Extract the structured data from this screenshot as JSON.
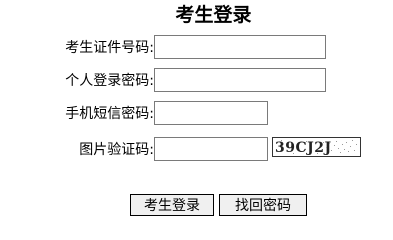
{
  "title": "考生登录",
  "form": {
    "fields": [
      {
        "label": "考生证件号码:",
        "value": ""
      },
      {
        "label": "个人登录密码:",
        "value": ""
      },
      {
        "label": "手机短信密码:",
        "value": ""
      },
      {
        "label": "图片验证码:",
        "value": ""
      }
    ],
    "captcha_text": "39CJ2J"
  },
  "buttons": {
    "login_label": "考生登录",
    "recover_label": "找回密码"
  }
}
